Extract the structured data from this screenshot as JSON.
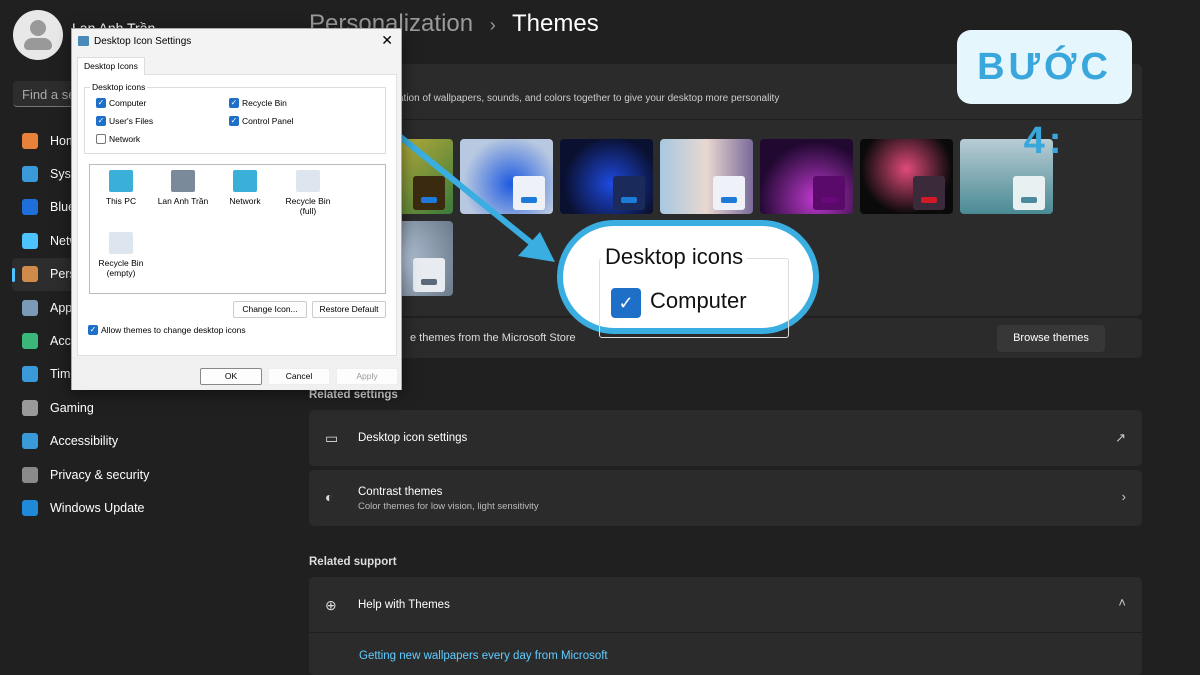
{
  "sidebar": {
    "user_name": "Lan Anh Trần",
    "search_placeholder": "Find a setting",
    "items": [
      {
        "label": "Home",
        "color": "#e8823a"
      },
      {
        "label": "System",
        "color": "#3a9ad9"
      },
      {
        "label": "Bluetooth & devices",
        "color": "#1e6fd9"
      },
      {
        "label": "Network & internet",
        "color": "#4cc2ff"
      },
      {
        "label": "Personalization",
        "color": "#d08a4a",
        "active": true
      },
      {
        "label": "Apps",
        "color": "#7a9ab8"
      },
      {
        "label": "Accounts",
        "color": "#3ab87a"
      },
      {
        "label": "Time & language",
        "color": "#3a9ad9"
      },
      {
        "label": "Gaming",
        "color": "#9a9a9a"
      },
      {
        "label": "Accessibility",
        "color": "#3a9ad9"
      },
      {
        "label": "Privacy & security",
        "color": "#8a8a8a"
      },
      {
        "label": "Windows Update",
        "color": "#1e8ad9"
      }
    ]
  },
  "main": {
    "breadcrumb_parent": "Personalization",
    "breadcrumb_sep": "›",
    "page_title": "Themes",
    "themes_desc": "ation of wallpapers, sounds, and colors together to give your desktop more personality",
    "store_text": "e themes from the Microsoft Store",
    "browse_button": "Browse themes",
    "related_settings": "Related settings",
    "desktop_icon_settings": "Desktop icon settings",
    "contrast_title": "Contrast themes",
    "contrast_sub": "Color themes for low vision, light sensitivity",
    "related_support": "Related support",
    "help_themes": "Help with Themes",
    "help_link": "Getting new wallpapers every day from Microsoft"
  },
  "themes": [
    {
      "bg": "linear-gradient(135deg,#d8b83a,#3a7a3a)",
      "win": "#3a2a10",
      "bar": "#1e7ad9"
    },
    {
      "bg": "radial-gradient(circle at 55% 60%,#1e5ae0,#b8c8e0 70%)",
      "win": "#eef2f8",
      "bar": "#1e7ad9"
    },
    {
      "bg": "radial-gradient(circle at 55% 60%,#1e4ae0,#0a1030 70%)",
      "win": "#1a2a5a",
      "bar": "#1e7ad9"
    },
    {
      "bg": "linear-gradient(90deg,#a8c8e0,#e8d8d0 50%,#7a6a9a)",
      "win": "#eef2f8",
      "bar": "#1e7ad9"
    },
    {
      "bg": "radial-gradient(circle at 60% 80%,#c03ad0,#200830 70%)",
      "win": "#5a0a6a",
      "bar": "#6a0a7a"
    },
    {
      "bg": "radial-gradient(circle at 50% 40%,#e04a7a,#0a0a0a 70%)",
      "win": "#3a2a3a",
      "bar": "#d01a2a"
    },
    {
      "bg": "linear-gradient(180deg,#b8ccd4,#4a8a94)",
      "win": "#e8f0f2",
      "bar": "#4a8a9a"
    },
    {
      "bg": "radial-gradient(circle at 40% 50%,#b8c8dc,#6a7a8a)",
      "win": "#e8ecf0",
      "bar": "#5a6a7a"
    }
  ],
  "badge": "BƯỚC 4:",
  "callout": {
    "group_label": "Desktop icons",
    "checkbox_label": "Computer",
    "checked": true
  },
  "dialog": {
    "title": "Desktop Icon Settings",
    "tab": "Desktop Icons",
    "group_label": "Desktop icons",
    "checkboxes": [
      {
        "label": "Computer",
        "checked": true
      },
      {
        "label": "Recycle Bin",
        "checked": true
      },
      {
        "label": "User's Files",
        "checked": true
      },
      {
        "label": "Control Panel",
        "checked": true
      },
      {
        "label": "Network",
        "checked": false
      }
    ],
    "icons": [
      {
        "label": "This PC",
        "color": "#3ab0d8"
      },
      {
        "label": "Lan Anh Trần",
        "color": "#7a8a9a"
      },
      {
        "label": "Network",
        "color": "#3ab0d8"
      },
      {
        "label": "Recycle Bin (full)",
        "color": "#dde6ee"
      },
      {
        "label": "Recycle Bin (empty)",
        "color": "#dde6ee"
      }
    ],
    "change_icon": "Change Icon...",
    "restore_default": "Restore Default",
    "allow_themes": "Allow themes to change desktop icons",
    "allow_checked": true,
    "ok": "OK",
    "cancel": "Cancel",
    "apply": "Apply"
  }
}
